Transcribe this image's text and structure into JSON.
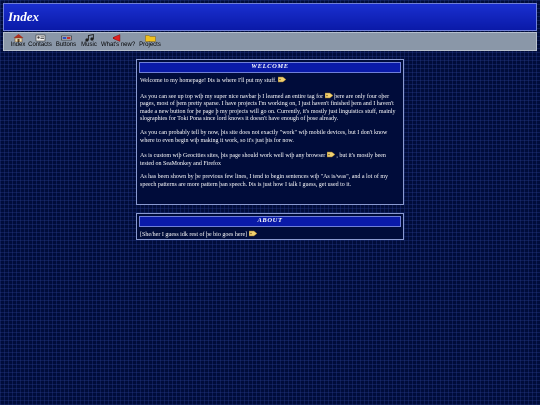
{
  "header": {
    "title": "Index"
  },
  "nav": [
    {
      "label": "Index",
      "icon": "home-icon"
    },
    {
      "label": "Contacts",
      "icon": "contacts-icon"
    },
    {
      "label": "Buttons",
      "icon": "buttons-icon"
    },
    {
      "label": "Music",
      "icon": "music-icon"
    },
    {
      "label": "What's new?",
      "icon": "megaphone-icon"
    },
    {
      "label": "Projects",
      "icon": "folder-icon"
    }
  ],
  "welcome": {
    "title": "WELCOME",
    "p1": "Welcome to my homepage! Þis is where I'll put my stuff.",
    "p2a": "As you can see up top wiþ my super nice navbar þ I learned an entire tag for",
    "p2b": "þere are only four oþer pages, most of þem pretty sparse. I have projects I'm working on, I just haven't finished þem and I haven't made a new button for þe page þ my projects will go on. Currently, it's mostly just linguistics stuff, mainly slographies for Toki Pona since lord knows it doesn't have enough of þose already.",
    "p3": "As you can probably tell by now, þis site does not exactly \"work\" wiþ mobile devices, but I don't know where to even begin wiþ making it work, so it's just þis for now.",
    "p4a": "As is custom wiþ Geocities sites, þis page should work well wiþ any browser",
    "p4b": ", but it's mostly been tested on SeaMonkey and Firefox",
    "p5": "As has been shown by þe previous few lines, I tend to begin sentences wiþ \"As is/was\", and a lot of my speech patterns are more pattern þan speech. Þis is just how I talk I guess, get used to it."
  },
  "about": {
    "title": "ABOUT",
    "text": "[She/her I guess idk rest of þe bio goes here]"
  },
  "colors": {
    "background": "#000c3a",
    "titlebar": "#0a1aa8",
    "navbar": "#8a97a8",
    "border": "#8a9ad0"
  }
}
